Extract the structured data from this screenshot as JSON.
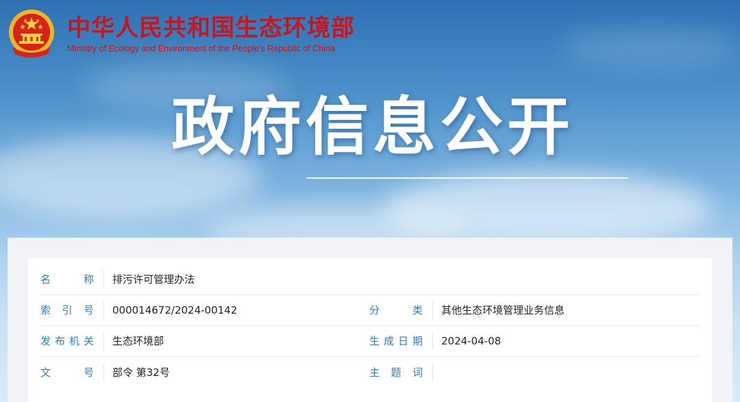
{
  "header": {
    "ministry_cn": "中华人民共和国生态环境部",
    "ministry_en": "Ministry of Ecology and Environment of the People's Republic of China",
    "emblem_icon": "national-emblem-icon",
    "brand_color": "#c8141a"
  },
  "hero": {
    "title": "政府信息公开"
  },
  "info": {
    "rows": [
      {
        "left": {
          "label": "名称",
          "value": "排污许可管理办法"
        }
      },
      {
        "left": {
          "label": "索引号",
          "value": "000014672/2024-00142"
        },
        "right": {
          "label": "分类",
          "value": "其他生态环境管理业务信息"
        }
      },
      {
        "left": {
          "label": "发布机关",
          "value": "生态环境部"
        },
        "right": {
          "label": "生成日期",
          "value": "2024-04-08"
        }
      },
      {
        "left": {
          "label": "文号",
          "value": "部令 第32号"
        },
        "right": {
          "label": "主题词",
          "value": ""
        }
      }
    ],
    "label_color": "#2e7cc4"
  }
}
